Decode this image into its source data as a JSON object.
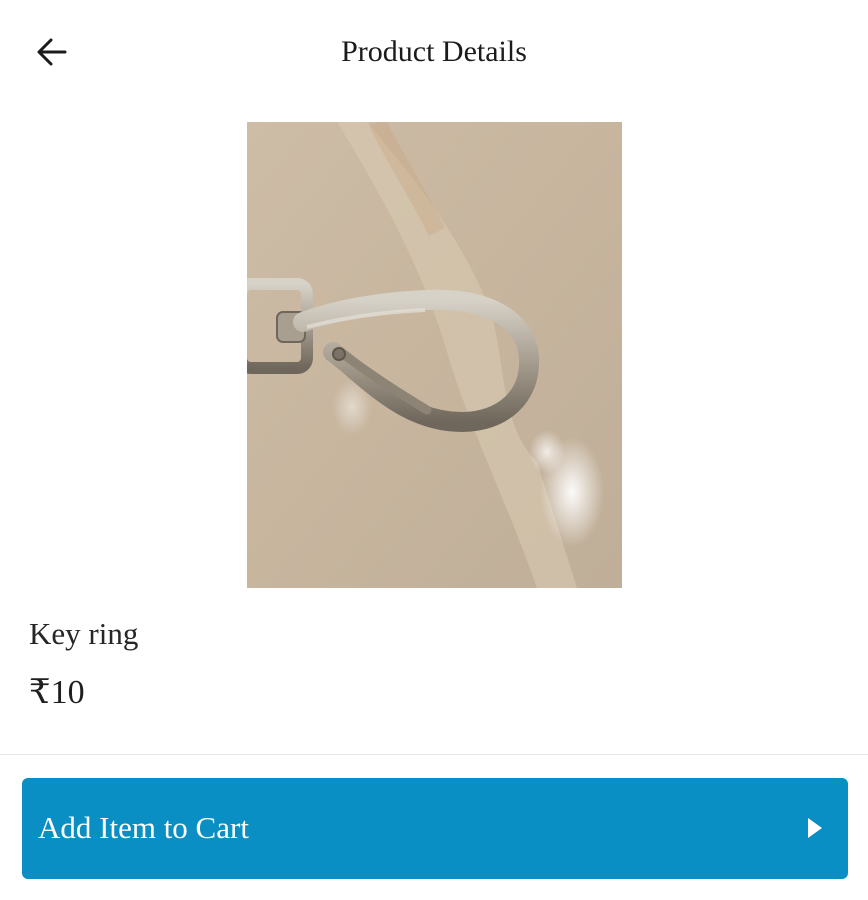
{
  "header": {
    "title": "Product Details",
    "back_icon": "arrow-left-icon"
  },
  "product": {
    "name": "Key ring",
    "price": "₹10",
    "image_icon": "product-photo"
  },
  "cta": {
    "label": "Add Item to Cart",
    "icon": "play-triangle-icon",
    "color": "#0a8fc4"
  }
}
